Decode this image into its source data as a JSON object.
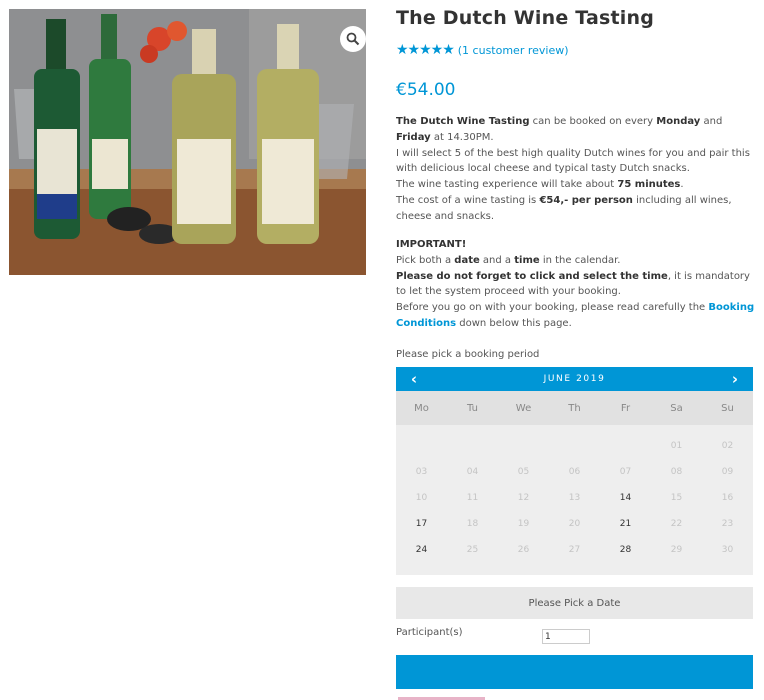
{
  "product": {
    "title": "The Dutch Wine Tasting",
    "rating_stars": "★★★★★",
    "rating_value": 5,
    "review_link": "(1 customer review)",
    "price": "€54.00"
  },
  "description": {
    "p1_bold_name": "The Dutch Wine Tasting",
    "p1_text1": " can be booked on every ",
    "p1_monday": "Monday",
    "p1_and": " and ",
    "p1_friday": "Friday",
    "p1_text2": " at 14.30PM.",
    "p2": "I will select 5 of the best high quality Dutch wines for you and pair this with delicious local cheese and typical tasty Dutch snacks.",
    "p3_text1": "The wine tasting experience will take about ",
    "p3_bold": "75 minutes",
    "p3_text2": ".",
    "p4_text1": "The cost of a wine tasting is ",
    "p4_bold": "€54,- per person",
    "p4_text2": " including all wines, cheese and snacks."
  },
  "important": {
    "heading": "IMPORTANT!",
    "l1_text1": "Pick both a ",
    "l1_date": "date",
    "l1_and": " and a ",
    "l1_time": "time",
    "l1_text2": " in the calendar.",
    "l2_bold": "Please do not forget to click and select the time",
    "l2_text": ", it is mandatory to let the system proceed with your booking.",
    "l3_text1": "Before you go on with your booking, please read carefully the ",
    "l3_link": "Booking Conditions",
    "l3_text2": " down below this page."
  },
  "booking": {
    "pick_label": "Please pick a booking period",
    "calendar": {
      "month": "JUNE 2019",
      "prev_icon": "‹",
      "next_icon": "›",
      "weekdays": [
        "Mo",
        "Tu",
        "We",
        "Th",
        "Fr",
        "Sa",
        "Su"
      ],
      "weeks": [
        [
          "",
          "",
          "",
          "",
          "",
          "01",
          "02"
        ],
        [
          "03",
          "04",
          "05",
          "06",
          "07",
          "08",
          "09"
        ],
        [
          "10",
          "11",
          "12",
          "13",
          "14",
          "15",
          "16"
        ],
        [
          "17",
          "18",
          "19",
          "20",
          "21",
          "22",
          "23"
        ],
        [
          "24",
          "25",
          "26",
          "27",
          "28",
          "29",
          "30"
        ]
      ],
      "available_days": [
        "14",
        "17",
        "21",
        "24",
        "28"
      ]
    },
    "pick_date_text": "Please Pick a Date",
    "participants_label": "Participant(s)",
    "participants_value": "1"
  },
  "icons": {
    "zoom": "search-icon",
    "star": "star-icon"
  },
  "colors": {
    "accent": "#0096d6",
    "calendar_header_days": "#e1e1e1",
    "calendar_body": "#eeeeee",
    "pick_date_bg": "#e8e8e8"
  }
}
